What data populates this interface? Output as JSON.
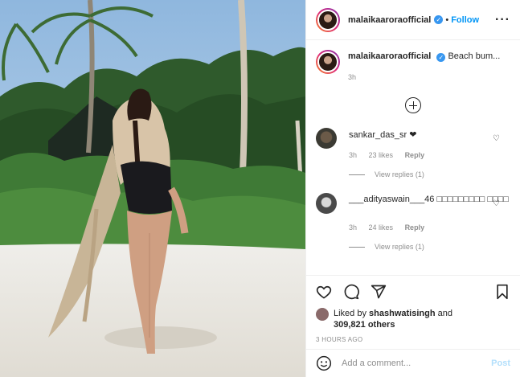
{
  "post": {
    "username": "malaikaaroraofficial",
    "follow_label": "Follow",
    "dot": "•",
    "more_label": "···",
    "caption": "Beach bum...",
    "caption_age": "3h"
  },
  "comments": [
    {
      "username": "sankar_das_sr",
      "text": "❤",
      "age": "3h",
      "likes": "23 likes",
      "reply_label": "Reply",
      "view_replies": "View replies (1)"
    },
    {
      "username": "___adityaswain___46",
      "text": "□□□□□□□□□ □□□□",
      "age": "3h",
      "likes": "24 likes",
      "reply_label": "Reply",
      "view_replies": "View replies (1)"
    }
  ],
  "likes": {
    "prefix": "Liked by ",
    "user": "shashwatisingh",
    "and": " and",
    "count": "309,821 others"
  },
  "timestamp": "3 HOURS AGO",
  "add_comment": {
    "placeholder": "Add a comment...",
    "post_label": "Post"
  },
  "colors": {
    "accent": "#0095f6",
    "muted": "#8e8e8e",
    "post_disabled": "#b2dffc"
  }
}
